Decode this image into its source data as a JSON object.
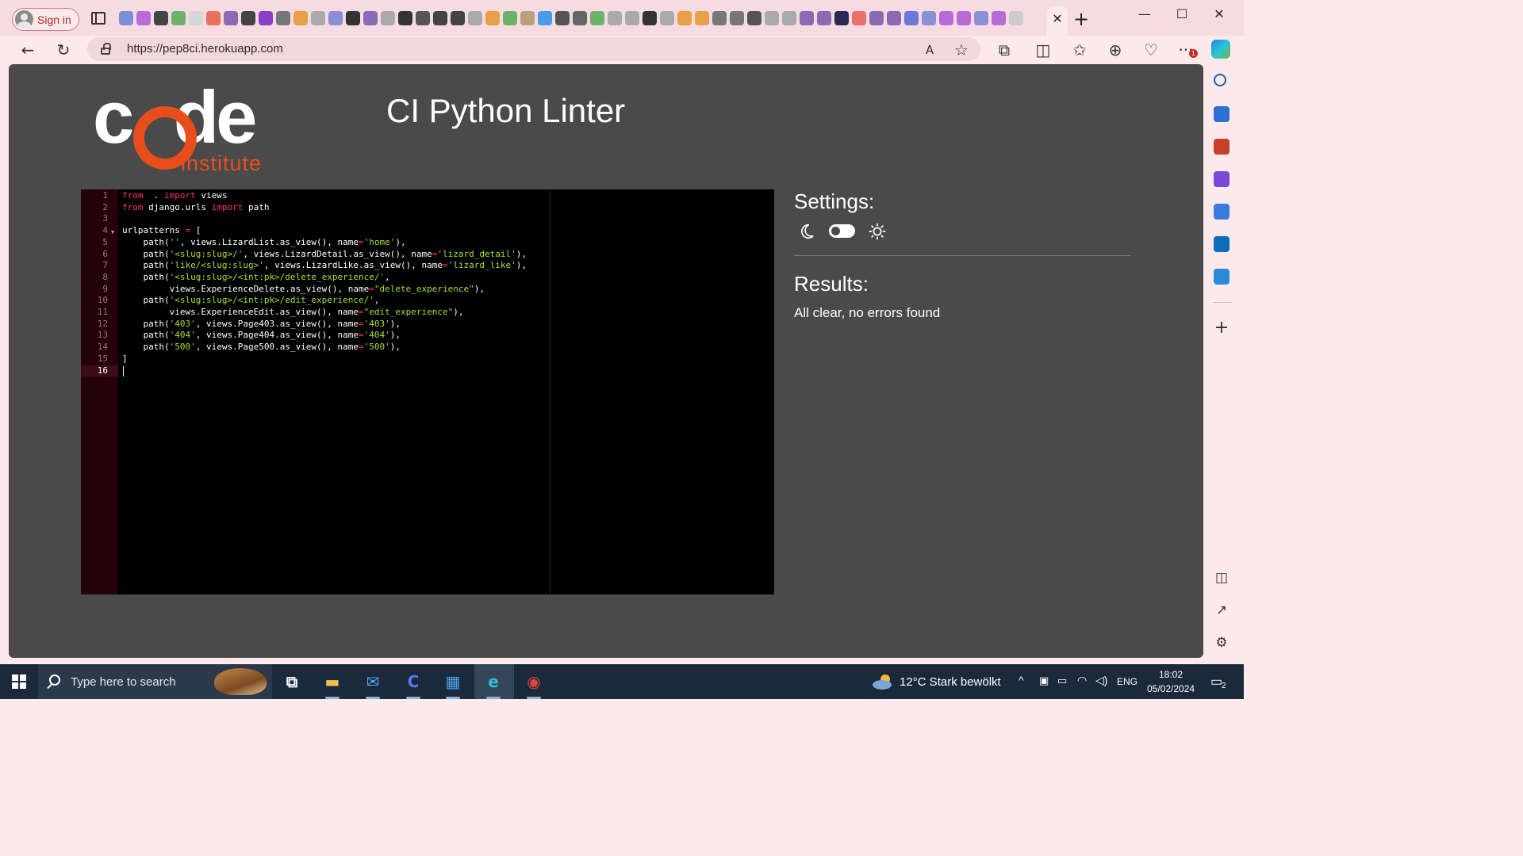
{
  "browser": {
    "signin_label": "Sign in",
    "url": "https://pep8ci.herokuapp.com",
    "notification_count": "1",
    "tab_close": "✕",
    "new_tab": "+",
    "window": {
      "minimize": "—",
      "maximize": "☐",
      "close": "✕"
    },
    "nav": {
      "back": "←",
      "refresh": "↻",
      "read_aloud": "A",
      "favorite": "☆",
      "extensions": "⧉",
      "split": "◫",
      "favorites_bar": "✩",
      "collections": "⊕",
      "performance": "♡",
      "more": "···"
    },
    "tab_favicon_colors": [
      "#7a8fd6",
      "#b86bd6",
      "#444",
      "#6bb36b",
      "#d6d6d6",
      "#e8715a",
      "#8a6ab3",
      "#444",
      "#8b3fc9",
      "#777",
      "#e8a04a",
      "#aaa",
      "#8a8fd6",
      "#333",
      "#8a6ab3",
      "#aaa",
      "#333",
      "#555",
      "#444",
      "#444",
      "#aaa",
      "#e8a04a",
      "#6bb36b",
      "#b8a07a",
      "#4a9be8",
      "#555",
      "#666",
      "#6bb36b",
      "#aaa",
      "#aaa",
      "#333",
      "#aaa",
      "#e8a04a",
      "#e8a04a",
      "#777",
      "#777",
      "#555",
      "#aaa",
      "#aaa",
      "#8a6ab3",
      "#8a6ab3",
      "#2a2a55",
      "#e8716a",
      "#8a6ab3",
      "#8a6ab3",
      "#6a7ad6",
      "#8a8fd6",
      "#b86bd6",
      "#b86bd6",
      "#8a8fd6",
      "#b86bd6",
      "#cccccc"
    ]
  },
  "sidebar": {
    "icons": [
      {
        "name": "search-icon",
        "color": "#1f5fa8"
      },
      {
        "name": "tag-icon",
        "color": "#2f6fd6"
      },
      {
        "name": "toolbox-icon",
        "color": "#c7402a"
      },
      {
        "name": "chess-icon",
        "color": "#7a4ad6"
      },
      {
        "name": "copilot-icon",
        "color": "#3a7ae0"
      },
      {
        "name": "outlook-icon",
        "color": "#0f6cbd"
      },
      {
        "name": "send-icon",
        "color": "#2a8ad6"
      }
    ],
    "add_glyph": "+",
    "sidebar_glyph": "◫",
    "external_glyph": "↗",
    "settings_glyph": "⚙"
  },
  "page": {
    "title": "CI Python Linter",
    "logo_word": "code",
    "logo_sub": "institute",
    "settings_heading": "Settings:",
    "results_heading": "Results:",
    "results_text": "All clear, no errors found",
    "brand_orange": "#e84e1b",
    "background": "#4a4a4a"
  },
  "editor": {
    "active_line": 16,
    "lines": [
      {
        "n": "1",
        "tokens": [
          [
            "kw",
            "from"
          ],
          [
            "",
            "  . "
          ],
          [
            "kw",
            "import"
          ],
          [
            "",
            " views"
          ]
        ]
      },
      {
        "n": "2",
        "tokens": [
          [
            "kw",
            "from"
          ],
          [
            "",
            " django.urls "
          ],
          [
            "kw",
            "import"
          ],
          [
            "",
            " path"
          ]
        ]
      },
      {
        "n": "3",
        "tokens": []
      },
      {
        "n": "4",
        "tokens": [
          [
            "",
            "urlpatterns "
          ],
          [
            "op",
            "="
          ],
          [
            "",
            " ["
          ]
        ]
      },
      {
        "n": "5",
        "tokens": [
          [
            "",
            "    path("
          ],
          [
            "str",
            "''"
          ],
          [
            "",
            ", views.LizardList.as_view(), name"
          ],
          [
            "op",
            "="
          ],
          [
            "str",
            "'home'"
          ],
          [
            "",
            "),"
          ]
        ]
      },
      {
        "n": "6",
        "tokens": [
          [
            "",
            "    path("
          ],
          [
            "str",
            "'<slug:slug>/'"
          ],
          [
            "",
            ", views.LizardDetail.as_view(), name"
          ],
          [
            "op",
            "="
          ],
          [
            "str",
            "'lizard_detail'"
          ],
          [
            "",
            "),"
          ]
        ]
      },
      {
        "n": "7",
        "tokens": [
          [
            "",
            "    path("
          ],
          [
            "str",
            "'like/<slug:slug>'"
          ],
          [
            "",
            ", views.LizardLike.as_view(), name"
          ],
          [
            "op",
            "="
          ],
          [
            "str",
            "'lizard_like'"
          ],
          [
            "",
            "),"
          ]
        ]
      },
      {
        "n": "8",
        "tokens": [
          [
            "",
            "    path("
          ],
          [
            "str",
            "'<slug:slug>/<int:pk>/delete_experience/'"
          ],
          [
            "",
            ","
          ]
        ]
      },
      {
        "n": "9",
        "tokens": [
          [
            "",
            "         views.ExperienceDelete.as_view(), name"
          ],
          [
            "op",
            "="
          ],
          [
            "str",
            "\"delete_experience\""
          ],
          [
            "",
            "),"
          ]
        ]
      },
      {
        "n": "10",
        "tokens": [
          [
            "",
            "    path("
          ],
          [
            "str",
            "'<slug:slug>/<int:pk>/edit_experience/'"
          ],
          [
            "",
            ","
          ]
        ]
      },
      {
        "n": "11",
        "tokens": [
          [
            "",
            "         views.ExperienceEdit.as_view(), name"
          ],
          [
            "op",
            "="
          ],
          [
            "str",
            "\"edit_experience\""
          ],
          [
            "",
            "),"
          ]
        ]
      },
      {
        "n": "12",
        "tokens": [
          [
            "",
            "    path("
          ],
          [
            "str",
            "'403'"
          ],
          [
            "",
            ", views.Page403.as_view(), name"
          ],
          [
            "op",
            "="
          ],
          [
            "str",
            "'403'"
          ],
          [
            "",
            "),"
          ]
        ]
      },
      {
        "n": "13",
        "tokens": [
          [
            "",
            "    path("
          ],
          [
            "str",
            "'404'"
          ],
          [
            "",
            ", views.Page404.as_view(), name"
          ],
          [
            "op",
            "="
          ],
          [
            "str",
            "'404'"
          ],
          [
            "",
            "),"
          ]
        ]
      },
      {
        "n": "14",
        "tokens": [
          [
            "",
            "    path("
          ],
          [
            "str",
            "'500'"
          ],
          [
            "",
            ", views.Page500.as_view(), name"
          ],
          [
            "op",
            "="
          ],
          [
            "str",
            "'500'"
          ],
          [
            "",
            "),"
          ]
        ]
      },
      {
        "n": "15",
        "tokens": [
          [
            "",
            "]"
          ]
        ]
      },
      {
        "n": "16",
        "tokens": []
      }
    ]
  },
  "taskbar": {
    "search_placeholder": "Type here to search",
    "weather": "12°C  Stark bewölkt",
    "language": "ENG",
    "time": "18:02",
    "date": "05/02/2024",
    "notification_count": "2",
    "apps": [
      {
        "name": "task-view-icon",
        "glyph": "⧉",
        "color": "#ffffff"
      },
      {
        "name": "file-explorer-icon",
        "glyph": "▬",
        "color": "#f2c14e"
      },
      {
        "name": "mail-icon",
        "glyph": "✉",
        "color": "#4aa3ef"
      },
      {
        "name": "copilot-taskbar-icon",
        "glyph": "C",
        "color": "#5a7af0"
      },
      {
        "name": "store-icon",
        "glyph": "▦",
        "color": "#4aa3ef"
      },
      {
        "name": "edge-icon",
        "glyph": "e",
        "color": "#2fbfe0"
      },
      {
        "name": "chrome-icon",
        "glyph": "◉",
        "color": "#e5433a"
      }
    ]
  }
}
